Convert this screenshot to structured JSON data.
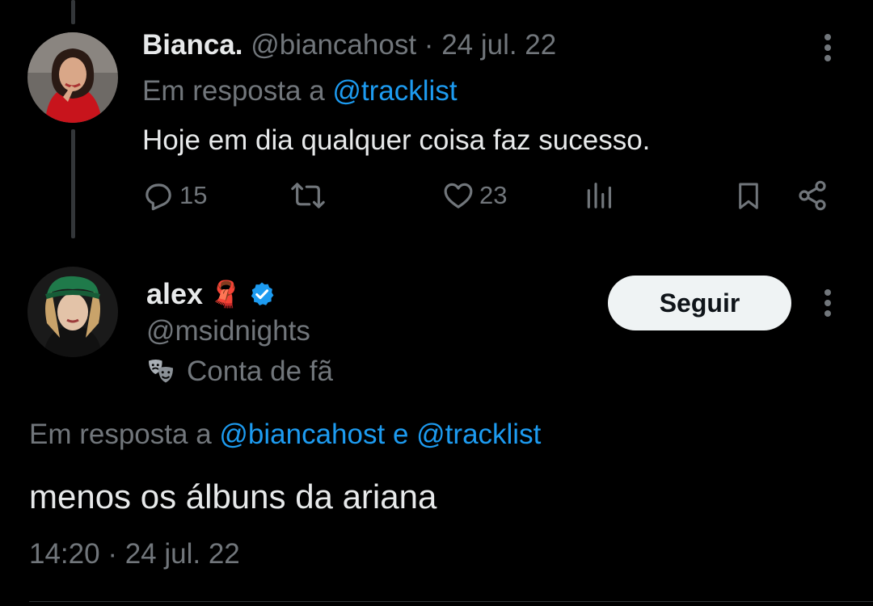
{
  "tweet1": {
    "name": "Bianca.",
    "handle": "@biancahost",
    "sep": "·",
    "date": "24 jul. 22",
    "reply_prefix": "Em resposta a",
    "reply_to": "@tracklist",
    "text": "Hoje em dia qualquer coisa faz sucesso.",
    "replies": "15",
    "likes": "23"
  },
  "tweet2": {
    "name": "alex",
    "name_emoji": "🧣",
    "handle": "@msidnights",
    "account_label": "Conta de fã",
    "label_icon": "theater-masks-icon",
    "follow_label": "Seguir",
    "reply_prefix": "Em resposta a",
    "reply_to_1": "@biancahost",
    "reply_conj": "e",
    "reply_to_2": "@tracklist",
    "text": "menos os álbuns da ariana",
    "time": "14:20",
    "sep": "·",
    "date": "24 jul. 22"
  },
  "colors": {
    "background": "#000000",
    "text": "#e7e9ea",
    "secondary": "#71767b",
    "accent": "#1d9bf0",
    "follow_bg": "#eff3f4"
  }
}
